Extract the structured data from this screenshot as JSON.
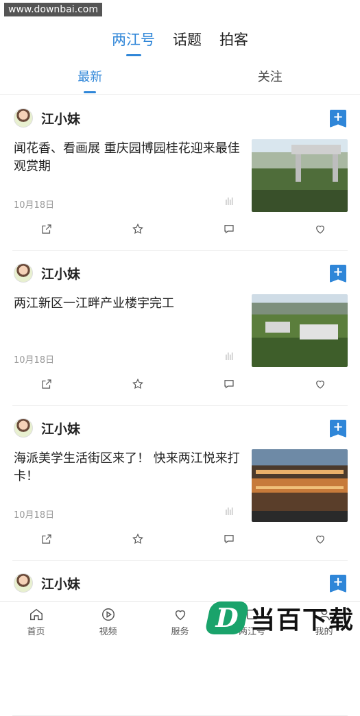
{
  "watermark": "www.downbai.com",
  "top_tabs": [
    "两江号",
    "话题",
    "拍客"
  ],
  "sub_tabs": [
    "最新",
    "关注"
  ],
  "feed": [
    {
      "author": "江小妹",
      "title": "闻花香、看画展 重庆园博园桂花迎来最佳观赏期",
      "date": "10月18日"
    },
    {
      "author": "江小妹",
      "title": "两江新区一江畔产业楼宇完工",
      "date": "10月18日"
    },
    {
      "author": "江小妹",
      "title": "海派美学生活街区来了！ 快来两江悦来打卡！",
      "date": "10月18日"
    },
    {
      "author": "江小妹",
      "title": "",
      "date": ""
    }
  ],
  "tabbar": [
    {
      "label": "首页",
      "icon": "home-icon"
    },
    {
      "label": "视频",
      "icon": "video-icon"
    },
    {
      "label": "服务",
      "icon": "service-icon"
    },
    {
      "label": "两江号",
      "icon": "channel-icon"
    },
    {
      "label": "我的",
      "icon": "user-icon"
    }
  ],
  "brand": {
    "mark": "D",
    "text": "当百下载"
  },
  "colors": {
    "accent": "#2f86d8",
    "brand_green": "#1aa36b"
  }
}
